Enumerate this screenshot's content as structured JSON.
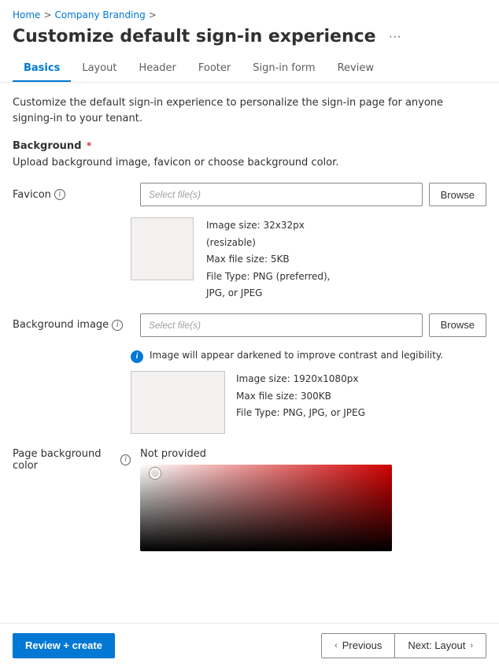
{
  "breadcrumb": {
    "home": "Home",
    "separator1": ">",
    "company_branding": "Company Branding",
    "separator2": ">"
  },
  "page": {
    "title": "Customize default sign-in experience",
    "ellipsis": "···"
  },
  "tabs": [
    {
      "id": "basics",
      "label": "Basics",
      "active": true
    },
    {
      "id": "layout",
      "label": "Layout",
      "active": false
    },
    {
      "id": "header",
      "label": "Header",
      "active": false
    },
    {
      "id": "footer",
      "label": "Footer",
      "active": false
    },
    {
      "id": "sign-in-form",
      "label": "Sign-in form",
      "active": false
    },
    {
      "id": "review",
      "label": "Review",
      "active": false
    }
  ],
  "description": "Customize the default sign-in experience to personalize the sign-in page for anyone signing-in to your tenant.",
  "sections": {
    "background": {
      "title": "Background",
      "instruction": "Upload background image, favicon or choose background color."
    }
  },
  "fields": {
    "favicon": {
      "label": "Favicon",
      "placeholder": "Select file(s)",
      "browse_btn": "Browse",
      "image_info": "Image size: 32x32px\n(resizable)\nMax file size: 5KB\nFile Type: PNG (preferred),\nJPG, or JPEG"
    },
    "background_image": {
      "label": "Background image",
      "placeholder": "Select file(s)",
      "browse_btn": "Browse",
      "info_banner": "Image will appear darkened to improve contrast and legibility.",
      "image_info": "Image size: 1920x1080px\nMax file size: 300KB\nFile Type: PNG, JPG, or JPEG"
    },
    "page_background_color": {
      "label": "Page background color",
      "value": "Not provided"
    }
  },
  "footer": {
    "review_create": "Review + create",
    "previous": "Previous",
    "next": "Next: Layout",
    "chevron_left": "‹",
    "chevron_right": "›"
  }
}
